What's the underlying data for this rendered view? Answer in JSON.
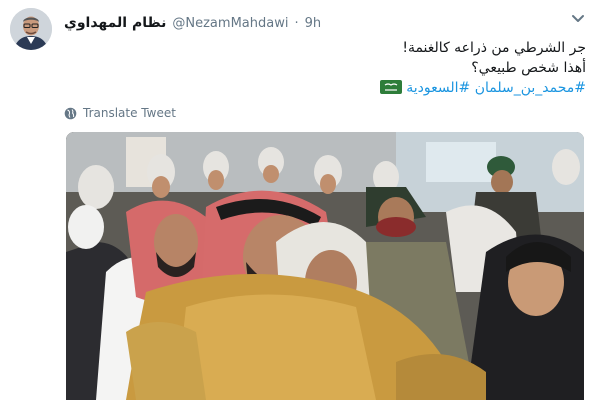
{
  "tweet": {
    "display_name": "نظام المهداوي",
    "handle": "@NezamMahdawi",
    "separator": "·",
    "time": "9h",
    "text_line_1": "جر الشرطي من ذراعه كالغنمة!",
    "text_line_2": "أهذا شخص طبيعي؟",
    "hashtags": [
      "#محمد_بن_سلمان",
      "#السعودية"
    ],
    "translate_label": "Translate Tweet"
  },
  "icons": {
    "menu": "chevron-down-icon",
    "translate": "globe-icon",
    "flag": "saudi-flag-emoji"
  },
  "colors": {
    "text": "#14171a",
    "secondary": "#657786",
    "link": "#1b95e0",
    "flag_green": "#2e7d3a"
  }
}
